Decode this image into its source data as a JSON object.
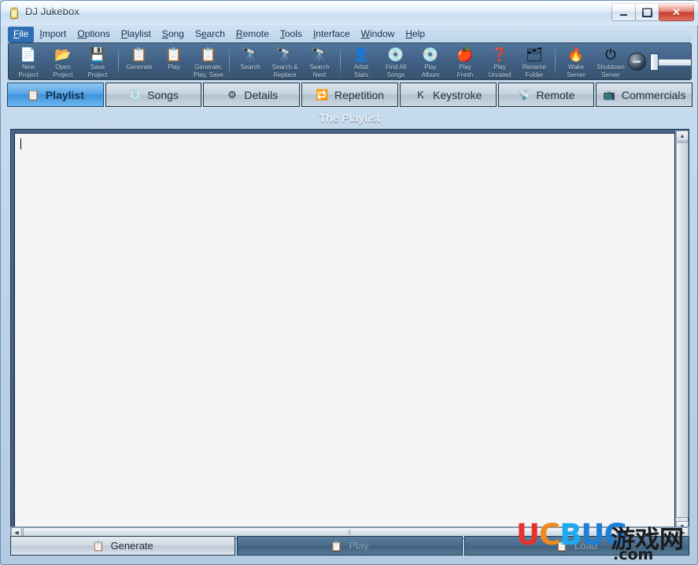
{
  "window": {
    "title": "DJ Jukebox",
    "icon": "jukebox-icon",
    "minimize_label": "–",
    "maximize_label": "□",
    "close_label": "✕"
  },
  "menubar": {
    "items": [
      {
        "label": "File",
        "accel": "F",
        "selected": true
      },
      {
        "label": "Import",
        "accel": "I",
        "selected": false
      },
      {
        "label": "Options",
        "accel": "O",
        "selected": false
      },
      {
        "label": "Playlist",
        "accel": "P",
        "selected": false
      },
      {
        "label": "Song",
        "accel": "S",
        "selected": false
      },
      {
        "label": "Search",
        "accel": "e",
        "selected": false
      },
      {
        "label": "Remote",
        "accel": "R",
        "selected": false
      },
      {
        "label": "Tools",
        "accel": "T",
        "selected": false
      },
      {
        "label": "Interface",
        "accel": "I",
        "selected": false
      },
      {
        "label": "Window",
        "accel": "W",
        "selected": false
      },
      {
        "label": "Help",
        "accel": "H",
        "selected": false
      }
    ]
  },
  "toolbar": {
    "groups": [
      {
        "buttons": [
          {
            "line1": "New",
            "line2": "Project",
            "icon": "new-document-icon",
            "glyph": "📄"
          },
          {
            "line1": "Open",
            "line2": "Project",
            "icon": "open-folder-icon",
            "glyph": "📂"
          },
          {
            "line1": "Save",
            "line2": "Project",
            "icon": "save-floppy-icon",
            "glyph": "💾"
          }
        ]
      },
      {
        "buttons": [
          {
            "line1": "Generate",
            "line2": "",
            "icon": "generate-clipboard-icon",
            "glyph": "📋"
          },
          {
            "line1": "Play",
            "line2": "",
            "icon": "play-clipboard-icon",
            "glyph": "📋"
          },
          {
            "line1": "Generate,",
            "line2": "Play, Save",
            "icon": "generate-play-save-icon",
            "glyph": "📋"
          }
        ]
      },
      {
        "buttons": [
          {
            "line1": "Search",
            "line2": "",
            "icon": "binoculars-icon",
            "glyph": "🔭"
          },
          {
            "line1": "Search &",
            "line2": "Replace",
            "icon": "search-replace-icon",
            "glyph": "🔭"
          },
          {
            "line1": "Search",
            "line2": "Next",
            "icon": "search-next-icon",
            "glyph": "🔭"
          }
        ]
      },
      {
        "buttons": [
          {
            "line1": "Artist",
            "line2": "Stats",
            "icon": "artist-person-icon",
            "glyph": "👤"
          },
          {
            "line1": "Find All",
            "line2": "Songs",
            "icon": "find-all-songs-icon",
            "glyph": "💿"
          },
          {
            "line1": "Play",
            "line2": "Album",
            "icon": "play-album-icon",
            "glyph": "💿"
          },
          {
            "line1": "Play",
            "line2": "Fresh",
            "icon": "apple-fresh-icon",
            "glyph": "🍎"
          },
          {
            "line1": "Play",
            "line2": "Unrated",
            "icon": "play-unrated-icon",
            "glyph": "❓"
          },
          {
            "line1": "Rename",
            "line2": "Folder",
            "icon": "rename-folder-icon",
            "glyph": "🗂"
          }
        ]
      },
      {
        "buttons": [
          {
            "line1": "Wake",
            "line2": "Server",
            "icon": "wake-server-icon",
            "glyph": "🔥"
          },
          {
            "line1": "Shutdown",
            "line2": "Server",
            "icon": "shutdown-server-icon",
            "glyph": "⏻"
          }
        ]
      }
    ],
    "volume": {
      "knob_icon": "volume-knob-icon",
      "slider_value": 0
    }
  },
  "tabs": [
    {
      "label": "Playlist",
      "icon": "playlist-clipboard-icon",
      "glyph": "📋",
      "active": true
    },
    {
      "label": "Songs",
      "icon": "songs-disc-icon",
      "glyph": "💿",
      "active": false
    },
    {
      "label": "Details",
      "icon": "details-gear-icon",
      "glyph": "⚙",
      "active": false
    },
    {
      "label": "Repetition",
      "icon": "repetition-refresh-icon",
      "glyph": "🔁",
      "active": false
    },
    {
      "label": "Keystroke",
      "icon": "keystroke-key-icon",
      "glyph": "K",
      "active": false
    },
    {
      "label": "Remote",
      "icon": "remote-control-icon",
      "glyph": "📡",
      "active": false
    },
    {
      "label": "Commercials",
      "icon": "commercials-tv-icon",
      "glyph": "📺",
      "active": false
    }
  ],
  "main": {
    "heading": "The Playlist",
    "editor_text": "",
    "scrollbars": {
      "up_arrow": "▲",
      "down_arrow": "▼",
      "left_arrow": "◀",
      "right_arrow": "▶",
      "grip": "⦀"
    }
  },
  "bottom_buttons": [
    {
      "label": "Generate",
      "icon": "generate-clipboard-icon",
      "glyph": "📋",
      "enabled": true
    },
    {
      "label": "Play",
      "icon": "play-clipboard-icon",
      "glyph": "📋",
      "enabled": false
    },
    {
      "label": "Load",
      "icon": "load-clipboard-icon",
      "glyph": "📋",
      "enabled": false
    }
  ],
  "watermark": {
    "part_u": "U",
    "part_c": "C",
    "part_b": "B",
    "part_ug": "UG",
    "chinese": "游戏网",
    "tld": ".com"
  },
  "colors": {
    "accent_blue": "#3d92de",
    "toolbar_bg": "#3f5f82",
    "content_bg": "#46678c",
    "editor_bg": "#f4f5f6",
    "close_red": "#c8392c"
  }
}
